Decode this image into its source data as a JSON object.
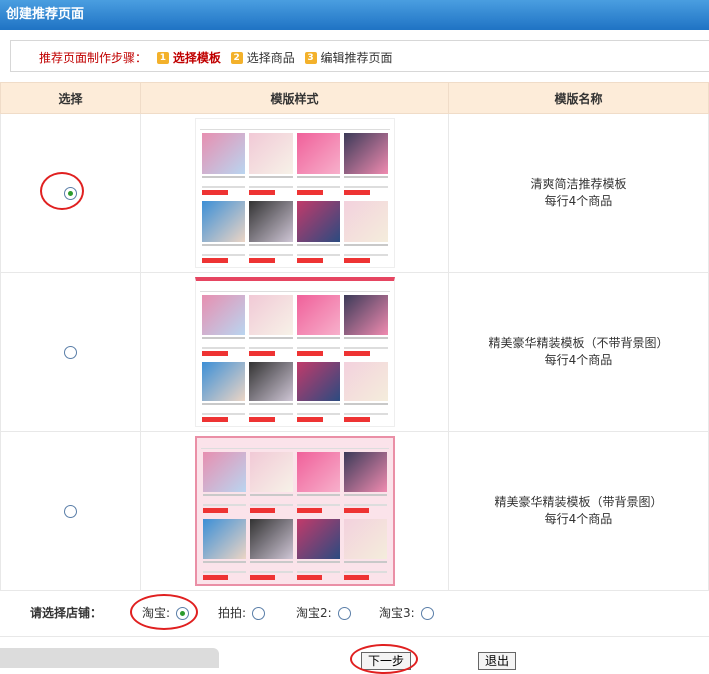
{
  "title": "创建推荐页面",
  "steps": {
    "label": "推荐页面制作步骤：",
    "items": [
      {
        "num": "1",
        "label": "选择模板"
      },
      {
        "num": "2",
        "label": "选择商品"
      },
      {
        "num": "3",
        "label": "编辑推荐页面"
      }
    ]
  },
  "table": {
    "headers": [
      "选择",
      "模版样式",
      "模版名称"
    ],
    "rows": [
      {
        "selected": true,
        "name": "清爽简洁推荐模板",
        "desc": "每行4个商品"
      },
      {
        "selected": false,
        "name": "精美豪华精装模板（不带背景图）",
        "desc": "每行4个商品"
      },
      {
        "selected": false,
        "name": "精美豪华精装模板（带背景图）",
        "desc": "每行4个商品"
      }
    ]
  },
  "store": {
    "label": "请选择店铺：",
    "options": [
      {
        "label": "淘宝:",
        "selected": true
      },
      {
        "label": "拍拍:",
        "selected": false
      },
      {
        "label": "淘宝2:",
        "selected": false
      },
      {
        "label": "淘宝3:",
        "selected": false
      }
    ]
  },
  "buttons": {
    "next": "下一步",
    "exit": "退出"
  },
  "colors": {
    "titlebar": "#1f73c4",
    "header_bg": "#fdecd9",
    "highlight_circle": "#e02020",
    "step_active": "#c00000"
  }
}
